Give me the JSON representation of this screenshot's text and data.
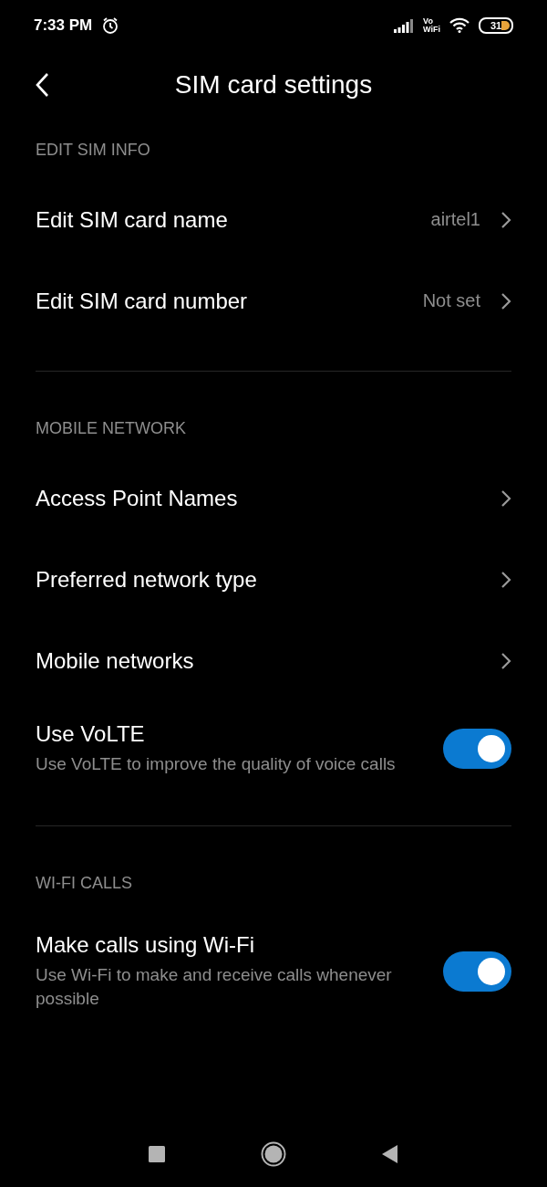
{
  "status_bar": {
    "time": "7:33 PM",
    "vowifi_top": "Vo",
    "vowifi_bottom": "WiFi",
    "battery": "31"
  },
  "header": {
    "title": "SIM card settings"
  },
  "sections": [
    {
      "title": "EDIT SIM INFO",
      "items": [
        {
          "kind": "link",
          "label": "Edit SIM card name",
          "value": "airtel1"
        },
        {
          "kind": "link",
          "label": "Edit SIM card number",
          "value": "Not set"
        }
      ]
    },
    {
      "title": "MOBILE NETWORK",
      "items": [
        {
          "kind": "link",
          "label": "Access Point Names"
        },
        {
          "kind": "link",
          "label": "Preferred network type"
        },
        {
          "kind": "link",
          "label": "Mobile networks"
        },
        {
          "kind": "toggle",
          "label": "Use VoLTE",
          "subtitle": "Use VoLTE to improve the quality of voice calls",
          "on": true
        }
      ]
    },
    {
      "title": "WI-FI CALLS",
      "items": [
        {
          "kind": "toggle",
          "label": "Make calls using Wi-Fi",
          "subtitle": "Use Wi-Fi to make and receive calls whenever possible",
          "on": true
        }
      ]
    }
  ]
}
